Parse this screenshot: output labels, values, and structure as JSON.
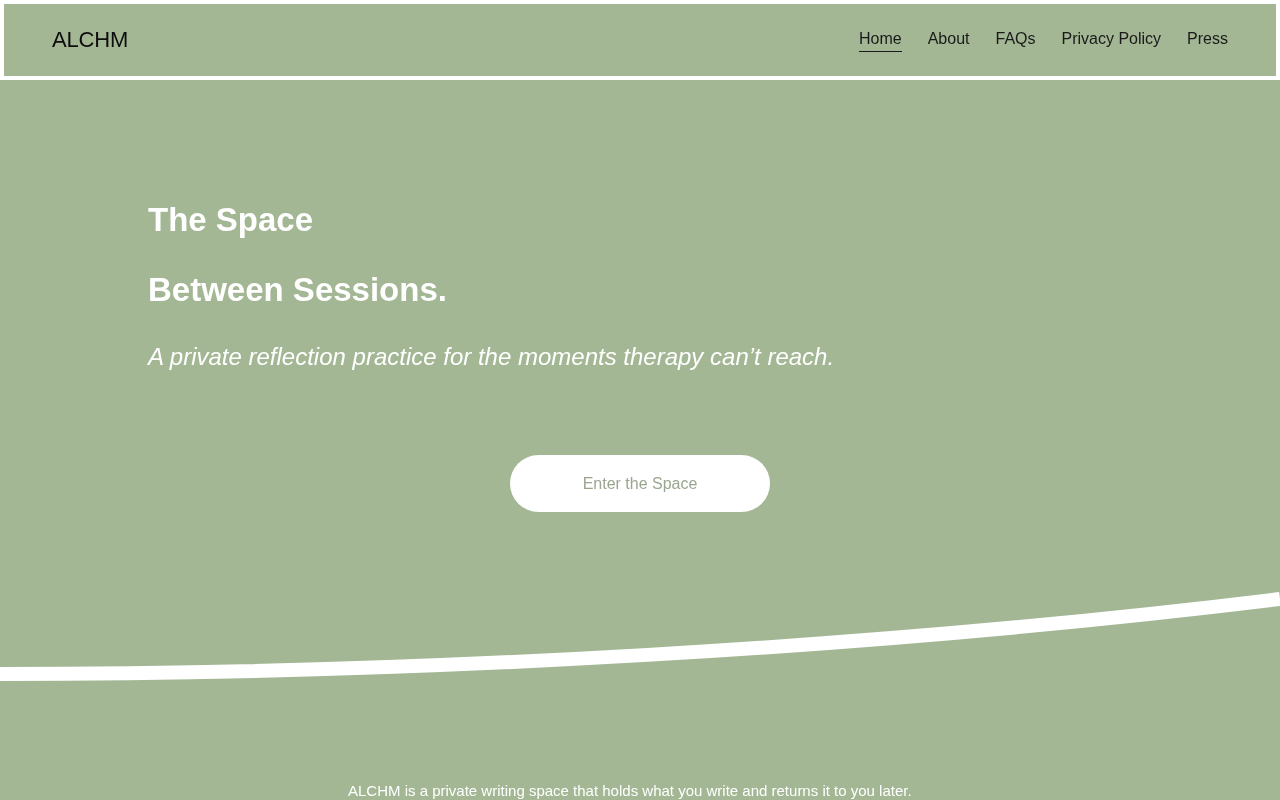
{
  "header": {
    "logo": "ALCHM",
    "nav": [
      {
        "label": "Home",
        "selected": true
      },
      {
        "label": "About",
        "selected": false
      },
      {
        "label": "FAQs",
        "selected": false
      },
      {
        "label": "Privacy Policy",
        "selected": false
      },
      {
        "label": "Press",
        "selected": false
      }
    ]
  },
  "hero": {
    "title_lines": [
      "The Space",
      "Between Sessions."
    ],
    "subtitle": "A private reflection practice for the moments therapy can’t reach.",
    "button": "Enter the Space"
  },
  "intro": {
    "text": "ALCHM is a private writing space that holds what you write and returns it to you later."
  }
}
